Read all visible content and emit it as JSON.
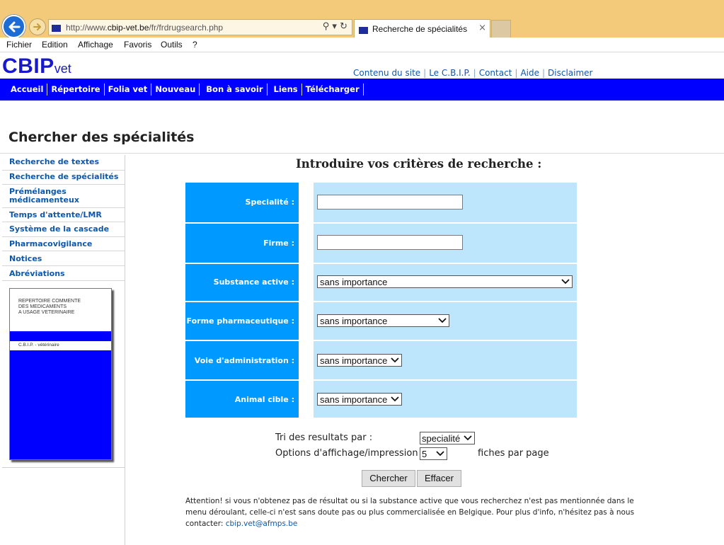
{
  "browser": {
    "url_prefix": "http://www.",
    "url_domain": "cbip-vet.be",
    "url_path": "/fr/frdrugsearch.php",
    "addr_icons": "⚲ ▾ ↻",
    "tab_title": "Recherche de spécialités",
    "tab_close": "×",
    "menu": [
      "Fichier",
      "Edition",
      "Affichage",
      "Favoris",
      "Outils",
      "?"
    ]
  },
  "site": {
    "logo_main": "CBIP",
    "logo_sub": "vet",
    "top_links": [
      "Contenu du site",
      "Le C.B.I.P.",
      "Contact",
      "Aide",
      "Disclaimer"
    ],
    "nav": [
      "Accueil",
      "Répertoire",
      "Folia vet",
      "Nouveau",
      "Bon à savoir",
      "Liens",
      "Télécharger"
    ]
  },
  "page": {
    "title": "Chercher des spécialités"
  },
  "sidebar": {
    "items": [
      "Recherche de textes",
      "Recherche de spécialités",
      "Prémélanges médicamenteux",
      "Temps d'attente/LMR",
      "Système de la cascade",
      "Pharmacovigilance",
      "Notices",
      "Abréviations"
    ],
    "book_title": "REPERTOIRE COMMENTE\nDES MEDICAMENTS\nA USAGE VETERINAIRE",
    "book_band": "C.B.I.P. - vétérinaire"
  },
  "form": {
    "heading": "Introduire vos critères de recherche :",
    "fields": {
      "specialite_label": "Specialité :",
      "firme_label": "Firme :",
      "substance_label": "Substance active :",
      "substance_value": "sans importance",
      "forme_label": "Forme pharmaceutique :",
      "forme_value": "sans importance",
      "voie_label": "Voie d'administration :",
      "voie_value": "sans importance",
      "animal_label": "Animal cible :",
      "animal_value": "sans importance"
    },
    "sort_label": "Tri des resultats par :",
    "sort_value": "specialité",
    "display_label": "Options d'affichage/impression :",
    "display_value": "5",
    "per_page_label": "fiches par page",
    "search_button": "Chercher",
    "clear_button": "Effacer",
    "notice_text": "Attention! si vous n'obtenez pas de résultat ou si la substance active que vous recherchez n'est pas mentionnée dans le menu déroulant, celle-ci n'est sans doute pas ou plus commercialisée en Belgique. Pour plus d'info, n'hésitez pas à nous contacter: ",
    "notice_email": "cbip.vet@afmps.be"
  },
  "colors": {
    "nav_blue": "#0000ff",
    "label_blue": "#0099ff",
    "value_lightblue": "#bde5fb",
    "link_blue": "#0f57a8"
  }
}
